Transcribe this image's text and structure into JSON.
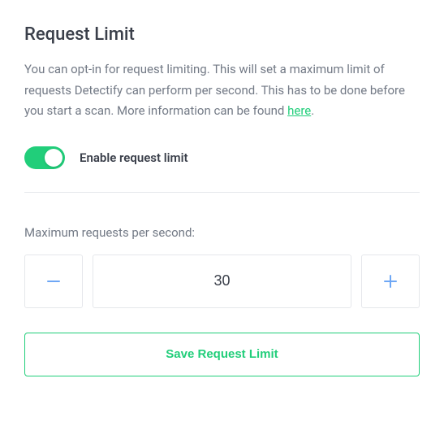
{
  "heading": "Request Limit",
  "description_text": "You can opt-in for request limiting. This will set a maximum limit of requests Detectify can perform per second. This has to be done before you start a scan. More information can be found ",
  "description_link": "here",
  "description_suffix": ".",
  "toggle": {
    "label": "Enable request limit",
    "enabled": true
  },
  "field_label": "Maximum requests per second:",
  "stepper": {
    "value": "30"
  },
  "save_button_label": "Save Request Limit",
  "colors": {
    "accent": "#21ce7a",
    "icon": "#6ea7f5"
  }
}
